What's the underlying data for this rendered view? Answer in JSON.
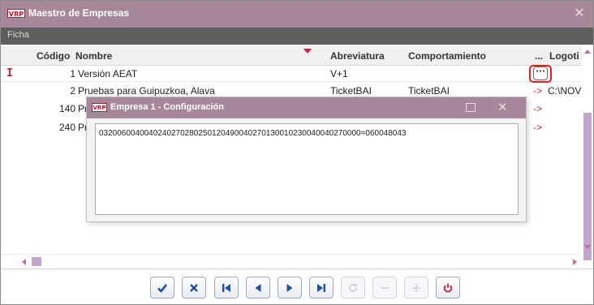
{
  "window": {
    "logo_text": "VRP",
    "title": "Maestro de Empresas",
    "close_glyph": "✕"
  },
  "tabs": [
    {
      "label": "Ficha"
    }
  ],
  "grid": {
    "columns": [
      "Código",
      "Nombre",
      "Abreviatura",
      "Comportamiento",
      "...",
      "Logoti"
    ],
    "rows": [
      {
        "indicator": "I",
        "code": "1",
        "name": "Versión AEAT",
        "abbr": "V+1",
        "behavior": "",
        "logo_arrow": "",
        "logo": "",
        "ellipsis": "···"
      },
      {
        "indicator": "",
        "code": "2",
        "name": "Pruebas para Guipuzkoa, Alava",
        "abbr": "TicketBAI",
        "behavior": "TicketBAI",
        "logo_arrow": "->",
        "logo": "C:\\NOV"
      },
      {
        "indicator": "",
        "code": "140",
        "name": "Pr",
        "abbr": "",
        "behavior": "",
        "logo_arrow": "->",
        "logo": ""
      },
      {
        "indicator": "",
        "code": "240",
        "name": "Pr",
        "abbr": "",
        "behavior": "",
        "logo_arrow": "->",
        "logo": ""
      }
    ]
  },
  "dialog": {
    "logo_text": "VRP",
    "title": "Empresa 1 - Configuración",
    "maximize_icon": "maximize-icon",
    "close_glyph": "✕",
    "memo_text": "0320060040040240270280250120490040270130010230040040270000=060048043"
  },
  "toolbar": {
    "buttons": [
      {
        "name": "post-button",
        "icon": "check-icon",
        "enabled": true
      },
      {
        "name": "cancel-button",
        "icon": "x-icon",
        "enabled": true
      },
      {
        "name": "first-button",
        "icon": "first-record-icon",
        "enabled": true
      },
      {
        "name": "prior-button",
        "icon": "prior-record-icon",
        "enabled": true
      },
      {
        "name": "next-button",
        "icon": "next-record-icon",
        "enabled": true
      },
      {
        "name": "last-button",
        "icon": "last-record-icon",
        "enabled": true
      },
      {
        "name": "refresh-button",
        "icon": "refresh-icon",
        "enabled": false
      },
      {
        "name": "delete-button",
        "icon": "minus-icon",
        "enabled": false
      },
      {
        "name": "insert-button",
        "icon": "plus-icon",
        "enabled": false
      },
      {
        "name": "exit-button",
        "icon": "power-icon",
        "enabled": true
      }
    ]
  },
  "colors": {
    "titlebar": "#a7879a",
    "tabbar": "#5e5e5e",
    "accent_red": "#d01f3c",
    "icon_blue": "#1f4fa8",
    "scroll_thumb": "#c4a4cc",
    "highlight_border": "#e0201c"
  }
}
